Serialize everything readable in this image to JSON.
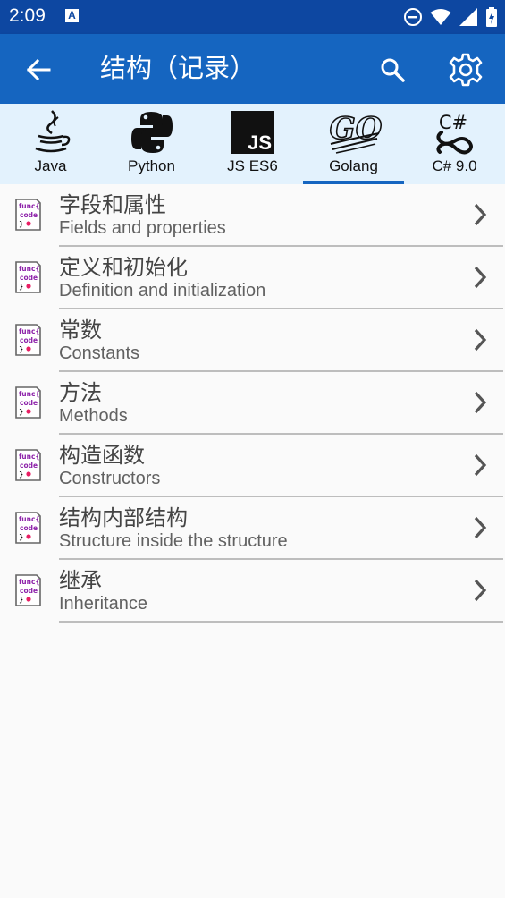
{
  "status_bar": {
    "time": "2:09",
    "notification_badge": "A"
  },
  "app_bar": {
    "title": "结构（记录）"
  },
  "tabs": [
    {
      "label": "Java",
      "icon": "java-icon"
    },
    {
      "label": "Python",
      "icon": "python-icon"
    },
    {
      "label": "JS ES6",
      "icon": "js-icon",
      "icon_text": "JS"
    },
    {
      "label": "Golang",
      "icon": "go-icon",
      "icon_text": "GO",
      "selected": true
    },
    {
      "label": "C# 9.0",
      "icon": "csharp-icon",
      "icon_text": "C#"
    }
  ],
  "code_icon": {
    "line1": "func{",
    "line2": "code",
    "line3": "}"
  },
  "items": [
    {
      "title": "字段和属性",
      "subtitle": "Fields and properties"
    },
    {
      "title": "定义和初始化",
      "subtitle": "Definition and initialization"
    },
    {
      "title": "常数",
      "subtitle": "Constants"
    },
    {
      "title": "方法",
      "subtitle": "Methods"
    },
    {
      "title": "构造函数",
      "subtitle": "Constructors"
    },
    {
      "title": "结构内部结构",
      "subtitle": "Structure inside the structure"
    },
    {
      "title": "继承",
      "subtitle": "Inheritance"
    }
  ],
  "colors": {
    "status_bar": "#0d47a1",
    "app_bar": "#1565c0",
    "tab_strip": "#e3f2fd",
    "tab_indicator": "#1565c0",
    "background": "#fafafa"
  }
}
